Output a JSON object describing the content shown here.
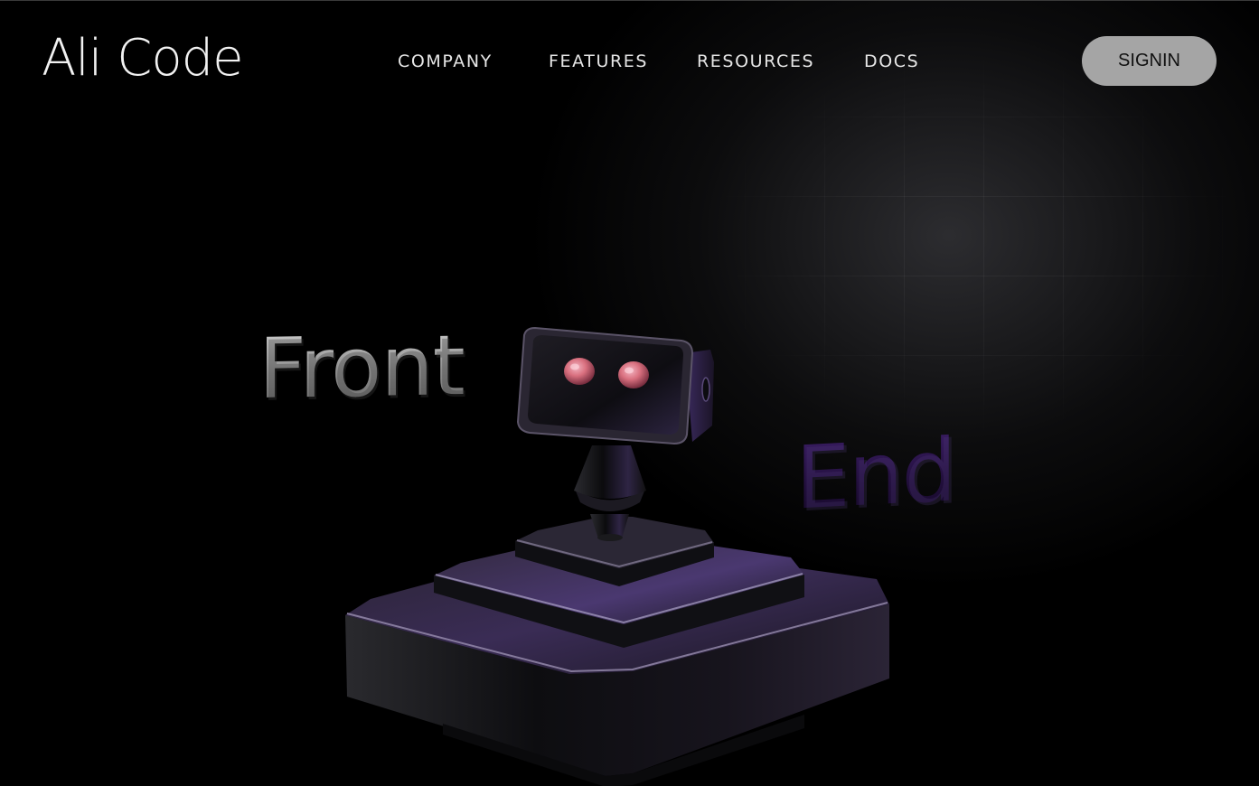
{
  "header": {
    "logo_text": "Ali Code",
    "nav": [
      {
        "label": "COMPANY"
      },
      {
        "label": "FEATURES"
      },
      {
        "label": "RESOURCES"
      },
      {
        "label": "DOCS"
      }
    ],
    "signin_label": "SIGNIN"
  },
  "hero": {
    "word_front": "Front",
    "word_end": "End",
    "illustration_icon": "robot-illustration-icon"
  },
  "colors": {
    "background": "#000000",
    "signin_button": "#a5a5a5",
    "accent_purple": "#2a1545",
    "robot_eyes": "#e07a8a"
  }
}
